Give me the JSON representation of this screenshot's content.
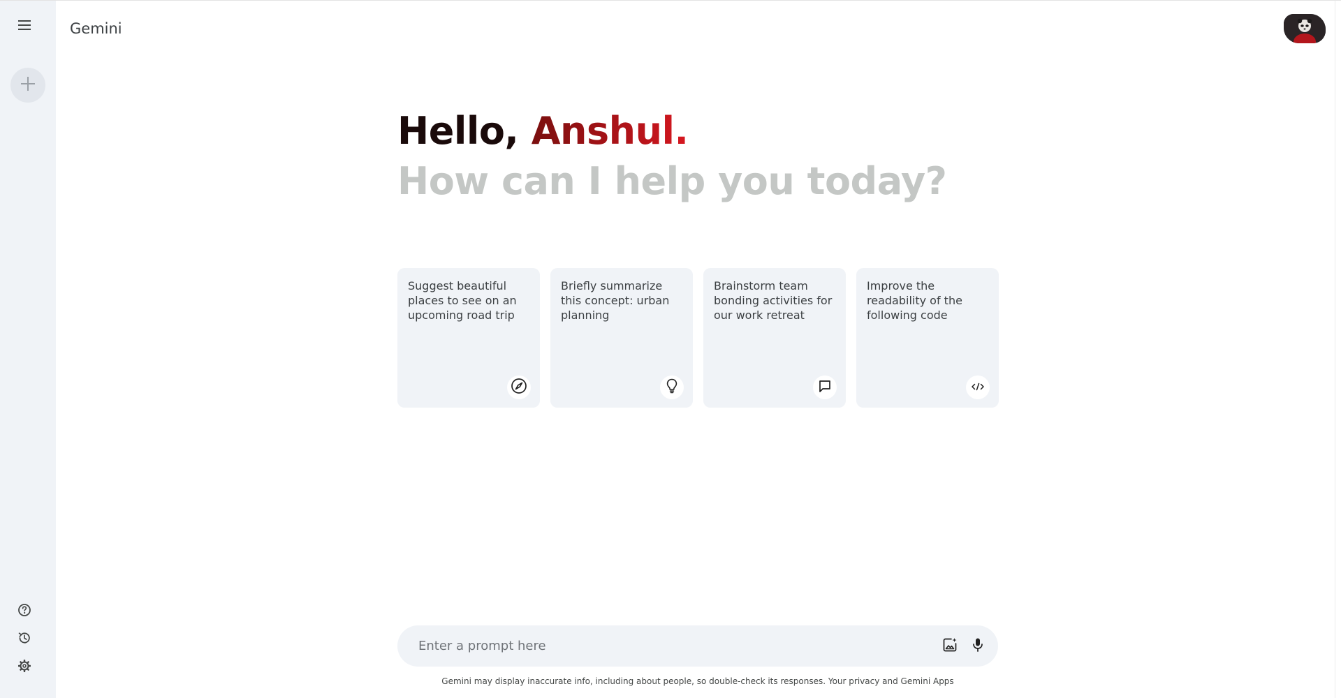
{
  "header": {
    "app_title": "Gemini"
  },
  "sidebar": {
    "menu_icon": "hamburger-menu-icon",
    "new_chat_icon": "plus-icon",
    "bottom_items": [
      {
        "icon": "help-icon"
      },
      {
        "icon": "history-icon"
      },
      {
        "icon": "gear-icon"
      }
    ]
  },
  "greeting": {
    "hello": "Hello, ",
    "name": "Anshul.",
    "subtitle": "How can I help you today?"
  },
  "cards": [
    {
      "text": "Suggest beautiful places to see on an upcoming road trip",
      "icon": "compass-icon"
    },
    {
      "text": "Briefly summarize this concept: urban planning",
      "icon": "lightbulb-icon"
    },
    {
      "text": "Brainstorm team bonding activities for our work retreat",
      "icon": "chat-bubble-icon"
    },
    {
      "text": "Improve the readability of the following code",
      "icon": "code-icon"
    }
  ],
  "prompt": {
    "placeholder": "Enter a prompt here",
    "value": ""
  },
  "disclaimer": {
    "text": "Gemini may display inaccurate info, including about people, so double-check its responses. ",
    "link": "Your privacy and Gemini Apps"
  },
  "colors": {
    "sidebar_bg": "#f0f3f7",
    "card_bg": "#f0f3f7",
    "name_gradient_start": "#7a0f0f",
    "name_gradient_end": "#d81820",
    "subtitle": "#c4c7c5"
  }
}
